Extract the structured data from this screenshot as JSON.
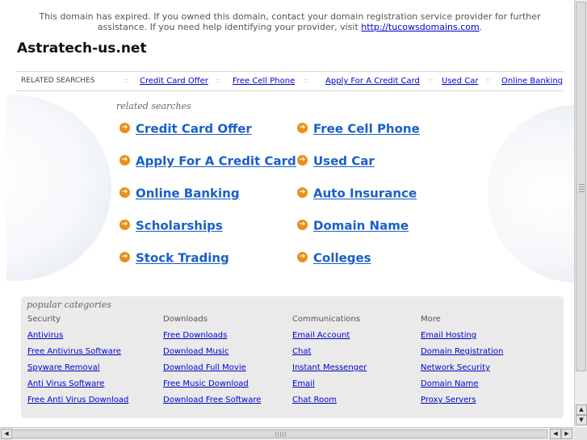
{
  "notice": {
    "text": "This domain has expired. If you owned this domain, contact your domain registration service provider for further assistance. If you need help identifying your provider, visit",
    "link_text": "http://tucowsdomains.com",
    "tail": "."
  },
  "site_title": "Astratech-us.net",
  "related_bar": {
    "label": "RELATED SEARCHES",
    "separator": "::",
    "links": [
      "Credit Card Offer",
      "Free Cell Phone",
      "Apply For A Credit Card",
      "Used Car",
      "Online Banking"
    ]
  },
  "related": {
    "heading": "related searches",
    "arrow_icon": "➔",
    "left": [
      "Credit Card Offer",
      "Apply For A Credit Card",
      "Online Banking",
      "Scholarships",
      "Stock Trading"
    ],
    "right": [
      "Free Cell Phone",
      "Used Car",
      "Auto Insurance",
      "Domain Name",
      "Colleges"
    ]
  },
  "popular": {
    "heading": "popular categories",
    "columns": [
      {
        "title": "Security",
        "links": [
          "Antivirus",
          "Free Antivirus Software",
          "Spyware Removal",
          "Anti Virus Software",
          "Free Anti Virus Download"
        ]
      },
      {
        "title": "Downloads",
        "links": [
          "Free Downloads",
          "Download Music",
          "Download Full Movie",
          "Free Music Download",
          "Download Free Software"
        ]
      },
      {
        "title": "Communications",
        "links": [
          "Email Account",
          "Chat",
          "Instant Messenger",
          "Email",
          "Chat Room"
        ]
      },
      {
        "title": "More",
        "links": [
          "Email Hosting",
          "Domain Registration",
          "Network Security",
          "Domain Name",
          "Proxy Servers"
        ]
      }
    ]
  },
  "colors": {
    "link": "#0000cc",
    "related_link": "#1a5fc9",
    "arrow": "#e8901a",
    "panel": "#eaeaea"
  },
  "scroll": {
    "up": "▲",
    "down": "▼",
    "left": "◀",
    "right": "▶"
  }
}
